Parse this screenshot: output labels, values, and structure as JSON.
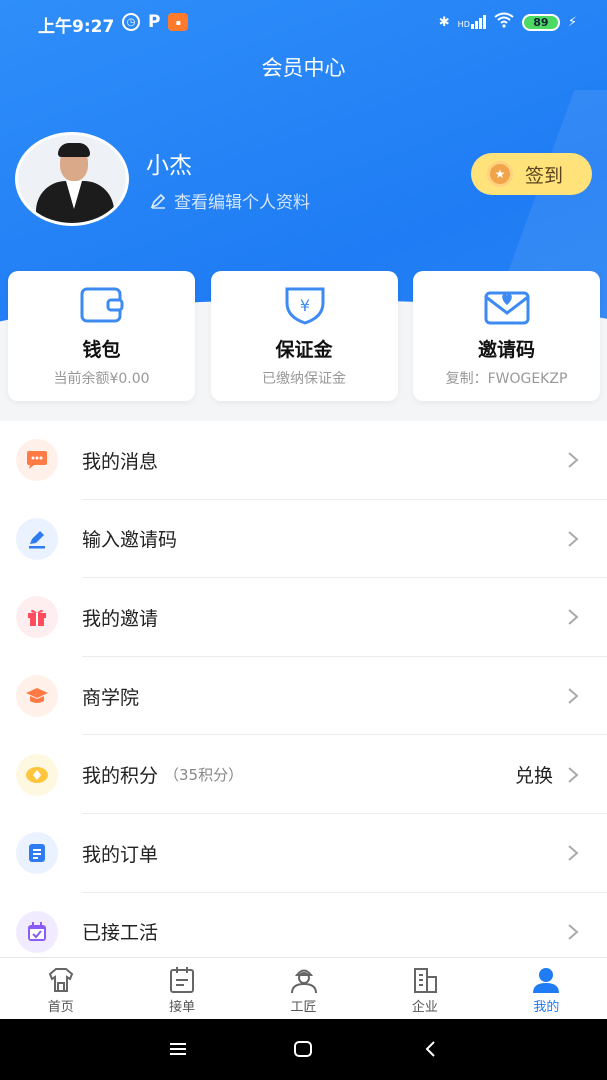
{
  "status_bar": {
    "time": "上午9:27",
    "hd": "HD",
    "battery": "89"
  },
  "header": {
    "title": "会员中心"
  },
  "profile": {
    "name": "小杰",
    "edit_label": "查看编辑个人资料",
    "checkin_label": "签到"
  },
  "cards": [
    {
      "title": "钱包",
      "subtitle": "当前余额¥0.00",
      "icon": "wallet-icon"
    },
    {
      "title": "保证金",
      "subtitle": "已缴纳保证金",
      "icon": "shield-yen-icon"
    },
    {
      "title": "邀请码",
      "subtitle": "复制：FWOGEKZP",
      "icon": "envelope-heart-icon"
    }
  ],
  "menu": [
    {
      "label": "我的消息",
      "icon": "chat-icon",
      "color": "#ff7a45"
    },
    {
      "label": "输入邀请码",
      "icon": "pen-icon",
      "color": "#2f7bf2"
    },
    {
      "label": "我的邀请",
      "icon": "gift-icon",
      "color": "#ff4d5e"
    },
    {
      "label": "商学院",
      "icon": "graduation-cap-icon",
      "color": "#ff7a45"
    },
    {
      "label": "我的积分",
      "extra": "（35积分）",
      "right": "兑换",
      "icon": "coin-icon",
      "color": "#ffc53d"
    },
    {
      "label": "我的订单",
      "icon": "document-icon",
      "color": "#2f7bf2"
    },
    {
      "label": "已接工活",
      "icon": "calendar-check-icon",
      "color": "#8a5cf5"
    }
  ],
  "tabs": [
    {
      "label": "首页",
      "icon": "shirt-home-icon"
    },
    {
      "label": "接单",
      "icon": "calendar-icon"
    },
    {
      "label": "工匠",
      "icon": "worker-icon"
    },
    {
      "label": "企业",
      "icon": "building-icon"
    },
    {
      "label": "我的",
      "icon": "person-icon",
      "active": true
    }
  ],
  "colors": {
    "primary": "#1f7cf4",
    "checkin_bg": "#ffe27a"
  }
}
